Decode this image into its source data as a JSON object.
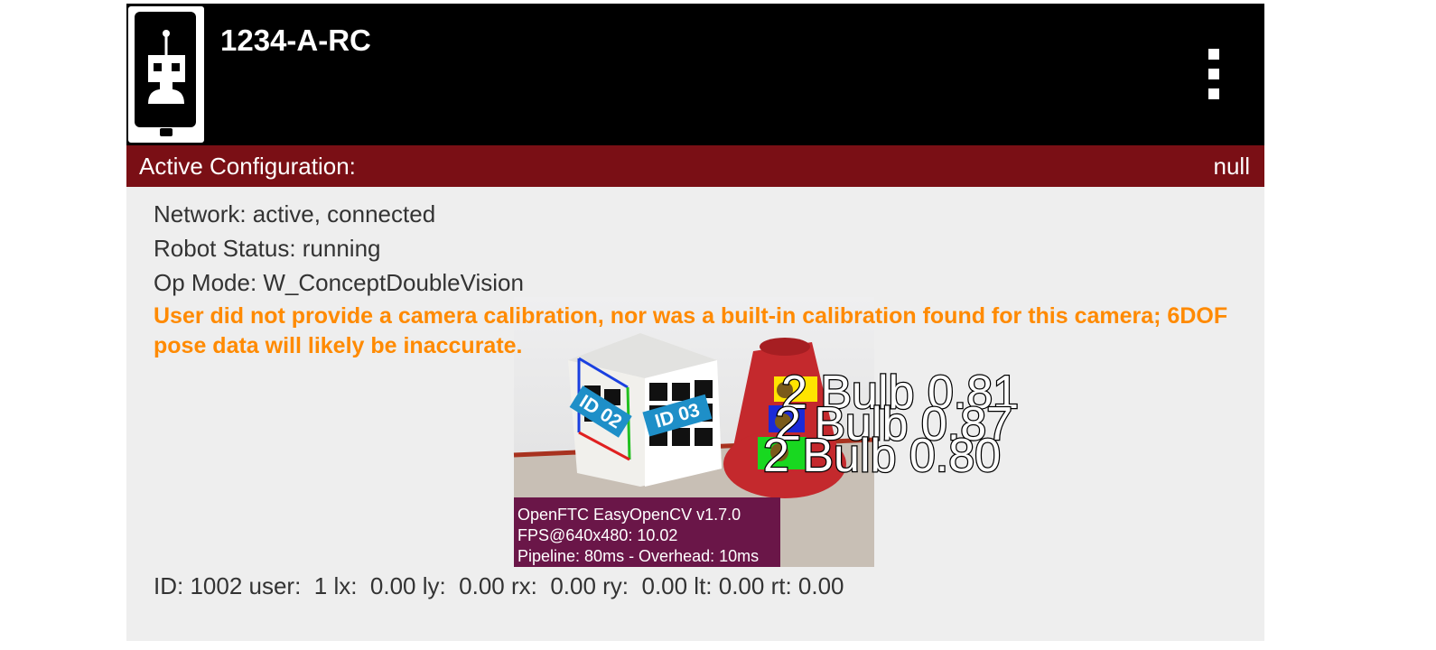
{
  "header": {
    "title": "1234-A-RC",
    "logo_icon": "robot-phone-icon",
    "menu_icon": "more-vert-icon"
  },
  "config": {
    "label": "Active Configuration:",
    "value": "null"
  },
  "status": {
    "network": "Network: active, connected",
    "robot": "Robot Status: running",
    "op_mode": "Op Mode: W_ConceptDoubleVision"
  },
  "warning": "User did not provide a camera calibration, nor was a built-in calibration found for this camera; 6DOF pose data will likely be inaccurate.",
  "camera": {
    "tags": [
      "ID 02",
      "ID 03"
    ],
    "detections": [
      "2 Bulb 0.81",
      "2 Bulb 0.87",
      "2 Bulb 0.80"
    ],
    "info": {
      "line1": "OpenFTC EasyOpenCV v1.7.0",
      "line2": "FPS@640x480: 10.02",
      "line3": "Pipeline: 80ms - Overhead: 10ms"
    }
  },
  "gamepad": "ID: 1002 user:  1 lx:  0.00 ly:  0.00 rx:  0.00 ry:  0.00 lt: 0.00 rt: 0.00",
  "colors": {
    "header_bg": "#000000",
    "config_bar": "#7a0f15",
    "warning": "#ff8a00",
    "info_bg": "#6a1648",
    "tag_label": "#1e8fc8"
  }
}
